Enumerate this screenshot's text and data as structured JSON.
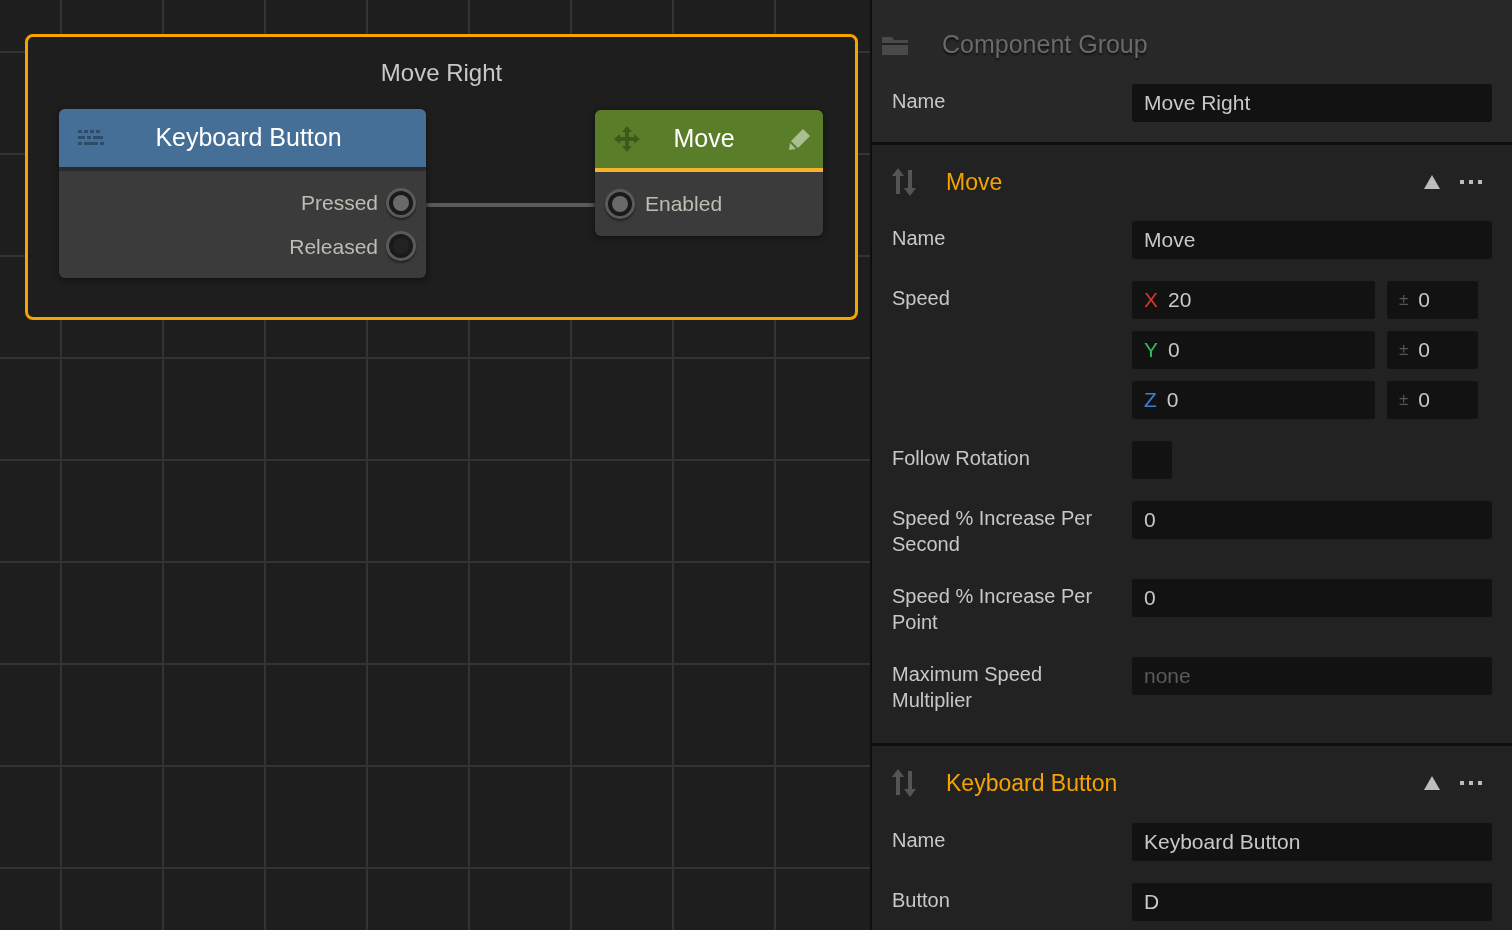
{
  "canvas": {
    "group": {
      "title": "Move Right",
      "selected": true
    },
    "nodes": [
      {
        "kind": "trigger",
        "title": "Keyboard Button",
        "color": "#456f96",
        "outputs": [
          {
            "label": "Pressed",
            "connected": true
          },
          {
            "label": "Released",
            "connected": false
          }
        ]
      },
      {
        "kind": "action",
        "title": "Move",
        "color": "#5a7d2a",
        "inputs": [
          {
            "label": "Enabled",
            "connected": true
          }
        ]
      }
    ]
  },
  "inspector": {
    "header": {
      "title": "Component Group"
    },
    "group_fields": [
      {
        "kind": "text",
        "label": "Name",
        "value": "Move Right"
      }
    ],
    "sections": [
      {
        "title": "Move",
        "expanded": true,
        "fields": [
          {
            "kind": "text",
            "label": "Name",
            "value": "Move"
          },
          {
            "kind": "vector",
            "label": "Speed",
            "axes": [
              {
                "axis": "X",
                "color": "#d9372e",
                "value": "20",
                "spread_sign": "±",
                "spread": "0"
              },
              {
                "axis": "Y",
                "color": "#2fbd5b",
                "value": "0",
                "spread_sign": "±",
                "spread": "0"
              },
              {
                "axis": "Z",
                "color": "#3c7fd8",
                "value": "0",
                "spread_sign": "±",
                "spread": "0"
              }
            ]
          },
          {
            "kind": "checkbox",
            "label": "Follow Rotation",
            "checked": false
          },
          {
            "kind": "text",
            "label": "Speed % Increase Per Second",
            "value": "0"
          },
          {
            "kind": "text",
            "label": "Speed % Increase Per Point",
            "value": "0"
          },
          {
            "kind": "text",
            "label": "Maximum Speed Multiplier",
            "placeholder": "none"
          }
        ]
      },
      {
        "title": "Keyboard Button",
        "expanded": true,
        "fields": [
          {
            "kind": "text",
            "label": "Name",
            "value": "Keyboard Button"
          },
          {
            "kind": "text",
            "label": "Button",
            "value": "D"
          }
        ]
      }
    ]
  }
}
